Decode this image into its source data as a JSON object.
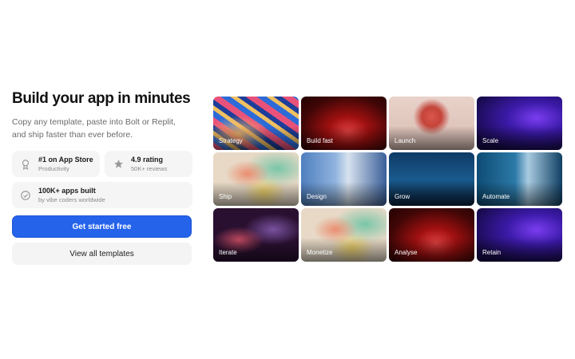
{
  "hero": {
    "headline": "Build your app in minutes",
    "subtitle": "Copy any template, paste into Bolt or Replit, and ship faster than ever before."
  },
  "stats": [
    {
      "title": "#1 on App Store",
      "subtitle": "Productivity",
      "icon": "award-icon"
    },
    {
      "title": "4.9 rating",
      "subtitle": "50K+ reviews",
      "icon": "star-icon"
    },
    {
      "title": "100K+ apps built",
      "subtitle": "by vibe coders worldwide",
      "icon": "check-circle-icon"
    }
  ],
  "actions": {
    "primary_label": "Get started free",
    "secondary_label": "View all templates"
  },
  "gallery": {
    "tiles": [
      {
        "label": "Strategy"
      },
      {
        "label": "Build fast"
      },
      {
        "label": "Launch"
      },
      {
        "label": "Scale"
      },
      {
        "label": "Ship"
      },
      {
        "label": "Design"
      },
      {
        "label": "Grow"
      },
      {
        "label": "Automate"
      },
      {
        "label": "Iterate"
      },
      {
        "label": "Monetize"
      },
      {
        "label": "Analyse"
      },
      {
        "label": "Retain"
      }
    ]
  },
  "colors": {
    "accent": "#2563eb",
    "card_bg": "#f5f5f6",
    "text": "#111111",
    "muted": "#6b6b6b"
  }
}
